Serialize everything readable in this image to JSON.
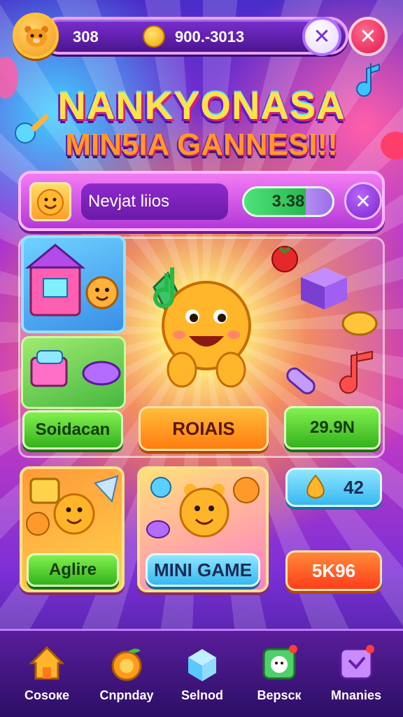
{
  "header": {
    "level_value": "308",
    "coins_value": "900.-3013",
    "close_symbol": "✕",
    "exit_symbol": "✕"
  },
  "title": {
    "line1": "NANKYONASA",
    "line2": "MIN5IA GANNESI!!"
  },
  "profile": {
    "name_field": "Nevjat liios",
    "score": "3.38",
    "close_symbol": "✕"
  },
  "board": {
    "left_button": "Soidacan",
    "center_button": "ROIAIS",
    "right_button": "29.9N"
  },
  "cards": {
    "card_left_button": "Aglire",
    "card_center_button": "MINI GAME",
    "gems_value": "42",
    "price_button": "5K96"
  },
  "nav": {
    "items": [
      {
        "label": "Cоsoке",
        "icon": "home-icon"
      },
      {
        "label": "Cnpnday",
        "icon": "orange-fruit-icon"
      },
      {
        "label": "Selnod",
        "icon": "ice-cube-icon"
      },
      {
        "label": "Bepscк",
        "icon": "pet-box-icon"
      },
      {
        "label": "Mnanies",
        "icon": "medal-box-icon"
      }
    ]
  },
  "colors": {
    "accent_purple": "#7a2fd0",
    "accent_pink": "#e3154e",
    "button_green": "#34b21d",
    "button_orange": "#ff7d10",
    "button_blue": "#36b8f0"
  }
}
